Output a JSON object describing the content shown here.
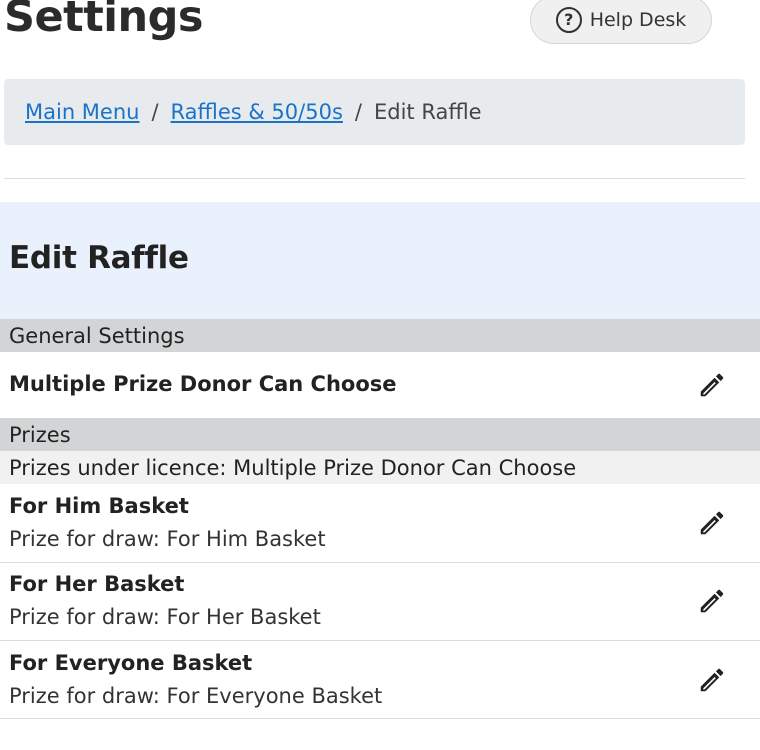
{
  "header": {
    "title": "Settings",
    "help_label": "Help Desk",
    "help_icon": "?"
  },
  "breadcrumb": {
    "items": [
      {
        "label": "Main Menu",
        "link": true
      },
      {
        "label": "Raffles & 50/50s",
        "link": true
      },
      {
        "label": "Edit Raffle",
        "link": false
      }
    ],
    "separator": "/"
  },
  "panel": {
    "title": "Edit Raffle"
  },
  "general": {
    "section_label": "General Settings",
    "item_title": "Multiple Prize Donor Can Choose"
  },
  "prizes": {
    "section_label": "Prizes",
    "sub_label": "Prizes under licence: Multiple Prize Donor Can Choose",
    "items": [
      {
        "title": "For Him Basket",
        "subtitle": "Prize for draw: For Him Basket"
      },
      {
        "title": "For Her Basket",
        "subtitle": "Prize for draw: For Her Basket"
      },
      {
        "title": "For Everyone Basket",
        "subtitle": "Prize for draw: For Everyone Basket"
      }
    ]
  },
  "icons": {
    "help": "question-circle-icon",
    "edit": "pencil-icon"
  },
  "colors": {
    "link": "#1a73c9",
    "panel_bg": "#e9f1fd",
    "section_bg": "#d3d4d5",
    "breadcrumb_bg": "#e8ebee"
  }
}
